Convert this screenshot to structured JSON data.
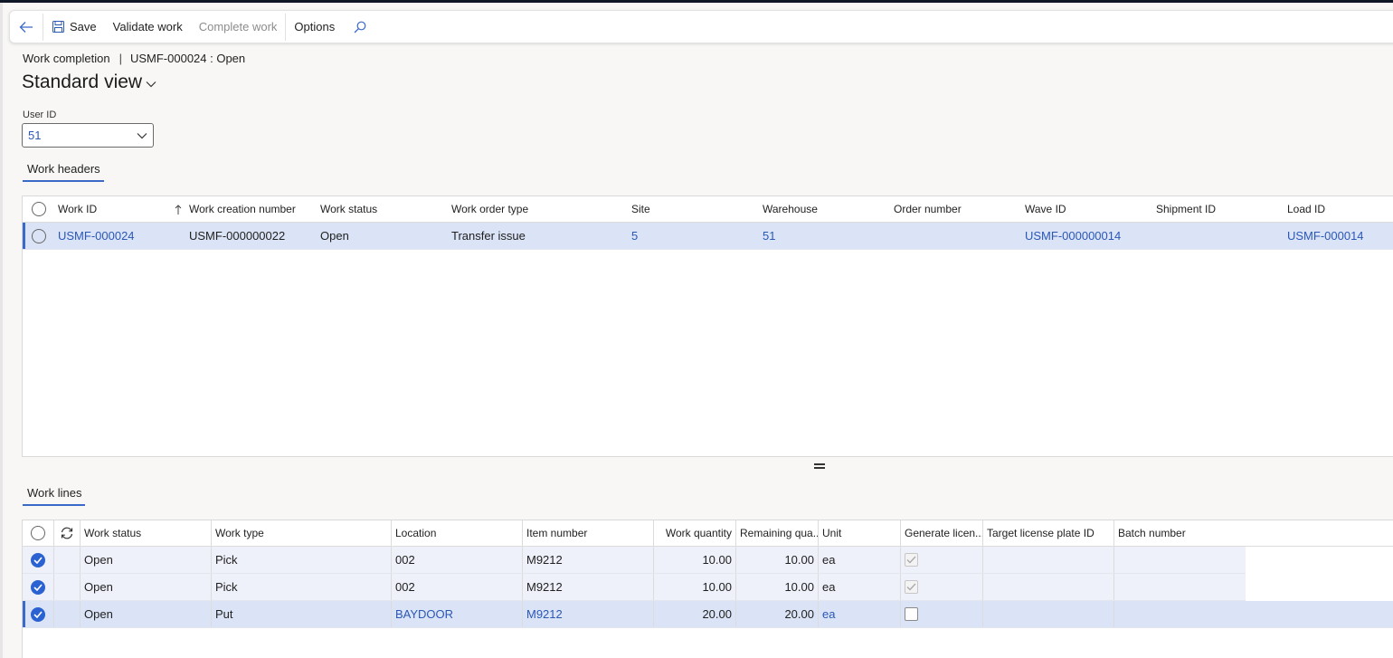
{
  "actionpane": {
    "save_label": "Save",
    "validate_label": "Validate work",
    "complete_label": "Complete work",
    "options_label": "Options"
  },
  "breadcrumb": {
    "form": "Work completion",
    "separator": "|",
    "record": "USMF-000024 : Open"
  },
  "view": {
    "title": "Standard view"
  },
  "userid": {
    "label": "User ID",
    "value": "51"
  },
  "headers": {
    "tab_label": "Work headers",
    "columns": [
      "Work ID",
      "Work creation number",
      "Work status",
      "Work order type",
      "Site",
      "Warehouse",
      "Order number",
      "Wave ID",
      "Shipment ID",
      "Load ID"
    ],
    "rows": [
      {
        "work_id": "USMF-000024",
        "creation_number": "USMF-000000022",
        "status": "Open",
        "order_type": "Transfer issue",
        "site": "5",
        "warehouse": "51",
        "order_number": "",
        "wave_id": "USMF-000000014",
        "shipment_id": "",
        "load_id": "USMF-000014"
      }
    ]
  },
  "lines": {
    "tab_label": "Work lines",
    "columns": [
      "Work status",
      "Work type",
      "Location",
      "Item number",
      "Work quantity",
      "Remaining qua...",
      "Unit",
      "Generate licen...",
      "Target license plate ID",
      "Batch number"
    ],
    "rows": [
      {
        "status": "Open",
        "type": "Pick",
        "location": "002",
        "item": "M9212",
        "qty": "10.00",
        "remaining": "10.00",
        "unit": "ea",
        "generate": true
      },
      {
        "status": "Open",
        "type": "Pick",
        "location": "002",
        "item": "M9212",
        "qty": "10.00",
        "remaining": "10.00",
        "unit": "ea",
        "generate": true
      },
      {
        "status": "Open",
        "type": "Put",
        "location": "BAYDOOR",
        "item": "M9212",
        "qty": "20.00",
        "remaining": "20.00",
        "unit": "ea",
        "generate": false
      }
    ]
  },
  "colors": {
    "accent": "#3b69c9",
    "link": "#2b57b5",
    "selected_row": "#dbe4f6"
  }
}
